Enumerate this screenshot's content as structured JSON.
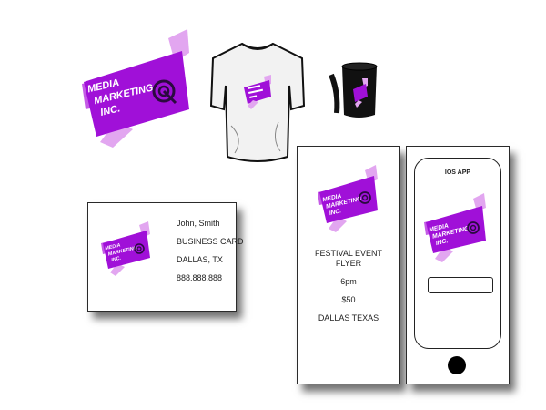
{
  "logo": {
    "line1": "MEDIA",
    "line2": "MARKETING",
    "line3": "INC."
  },
  "colors": {
    "brand_purple": "#a010d8",
    "brand_light": "#e2a6f0",
    "brand_mid": "#c45ae6"
  },
  "business_card": {
    "name": "John, Smith",
    "title": "BUSINESS CARD",
    "location": "DALLAS, TX",
    "phone": "888.888.888"
  },
  "flyer": {
    "line1": "FESTIVAL EVENT",
    "line2": "FLYER",
    "time": "6pm",
    "price": "$50",
    "location": "DALLAS TEXAS"
  },
  "app": {
    "title": "IOS APP"
  }
}
